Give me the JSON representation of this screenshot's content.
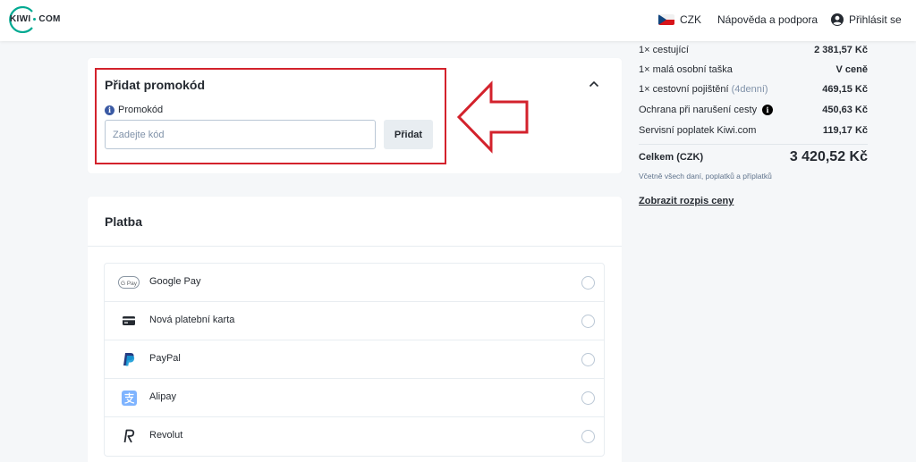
{
  "header": {
    "logo_text_left": "KIWI",
    "logo_text_right": "COM",
    "currency": "CZK",
    "help": "Nápověda a podpora",
    "login": "Přihlásit se"
  },
  "promo": {
    "title": "Přidat promokód",
    "label": "Promokód",
    "input_placeholder": "Zadejte kód",
    "input_value": "",
    "button": "Přidat"
  },
  "payment": {
    "title": "Platba",
    "options": [
      {
        "label": "Google Pay",
        "icon": "google-pay-icon",
        "icon_text": "G Pay"
      },
      {
        "label": "Nová platební karta",
        "icon": "credit-card-icon"
      },
      {
        "label": "PayPal",
        "icon": "paypal-icon"
      },
      {
        "label": "Alipay",
        "icon": "alipay-icon"
      },
      {
        "label": "Revolut",
        "icon": "revolut-icon"
      }
    ]
  },
  "summary": {
    "items": [
      {
        "label": "1× cestující",
        "value": "2 381,57 Kč"
      },
      {
        "label": "1× malá osobní taška",
        "value": "V ceně"
      },
      {
        "label": "1× cestovní pojištění",
        "label_extra": "(4denní)",
        "value": "469,15 Kč"
      },
      {
        "label": "Ochrana při narušení cesty",
        "value": "450,63 Kč"
      },
      {
        "label": "Servisní poplatek Kiwi.com",
        "value": "119,17 Kč"
      }
    ],
    "total_label": "Celkem (CZK)",
    "total_value": "3 420,52 Kč",
    "total_note": "Včetně všech daní, poplatků a příplatků",
    "breakdown_link": "Zobrazit rozpis ceny"
  },
  "colors": {
    "accent_teal": "#00a991",
    "annotation_red": "#d3222c"
  }
}
